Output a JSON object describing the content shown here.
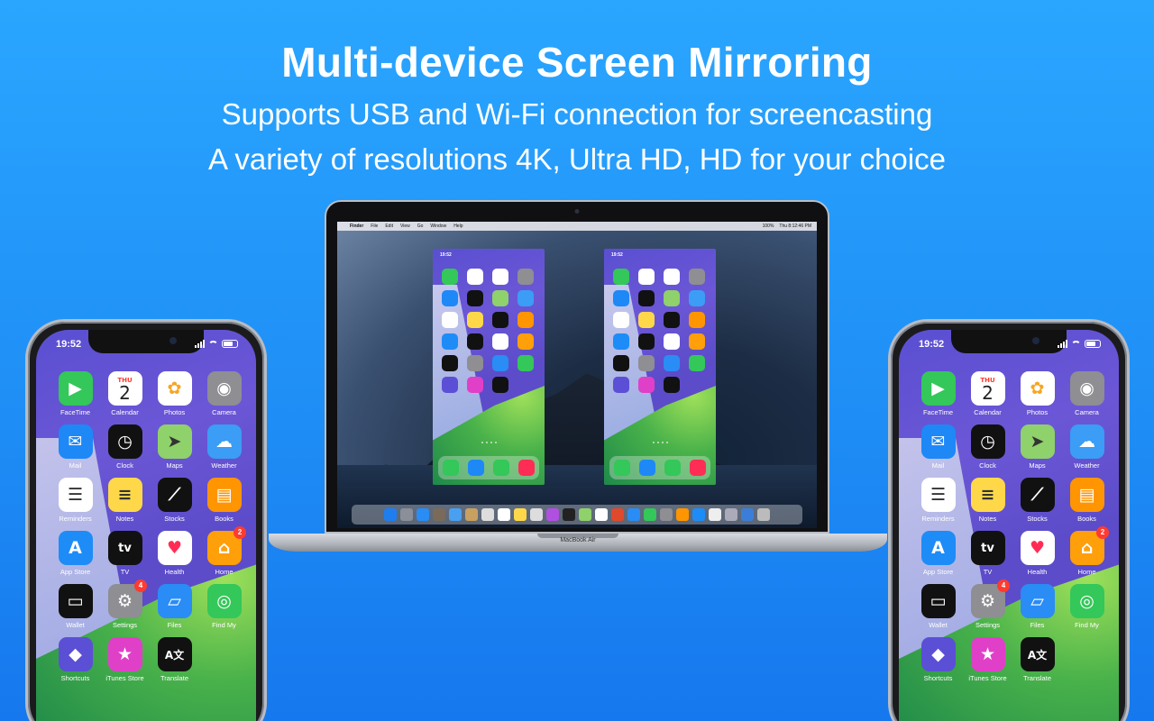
{
  "headline": {
    "title": "Multi-device Screen Mirroring",
    "line1": "Supports USB and Wi-Fi connection for screencasting",
    "line2": "A variety of resolutions 4K, Ultra HD, HD for your choice"
  },
  "phone": {
    "time": "19:52",
    "calendar_dow": "THU",
    "calendar_day": "2",
    "apps": [
      {
        "label": "FaceTime",
        "icon": "facetime-icon",
        "color": "#34c759",
        "glyph": "▶"
      },
      {
        "label": "Calendar",
        "icon": "calendar-icon",
        "color": "#ffffff",
        "glyph": ""
      },
      {
        "label": "Photos",
        "icon": "photos-icon",
        "color": "#ffffff",
        "glyph": "✿"
      },
      {
        "label": "Camera",
        "icon": "camera-icon",
        "color": "#8e8e93",
        "glyph": "◉"
      },
      {
        "label": "Mail",
        "icon": "mail-icon",
        "color": "#1e88f7",
        "glyph": "✉"
      },
      {
        "label": "Clock",
        "icon": "clock-icon",
        "color": "#111111",
        "glyph": "◷"
      },
      {
        "label": "Maps",
        "icon": "maps-icon",
        "color": "#8fd16a",
        "glyph": "➤"
      },
      {
        "label": "Weather",
        "icon": "weather-icon",
        "color": "#3b9df5",
        "glyph": "☁"
      },
      {
        "label": "Reminders",
        "icon": "reminders-icon",
        "color": "#ffffff",
        "glyph": "☰"
      },
      {
        "label": "Notes",
        "icon": "notes-icon",
        "color": "#ffd84a",
        "glyph": "≡"
      },
      {
        "label": "Stocks",
        "icon": "stocks-icon",
        "color": "#111111",
        "glyph": "⟋"
      },
      {
        "label": "Books",
        "icon": "books-icon",
        "color": "#ff9500",
        "glyph": "▤"
      },
      {
        "label": "App Store",
        "icon": "app-store-icon",
        "color": "#1e8cf7",
        "glyph": "A"
      },
      {
        "label": "TV",
        "icon": "tv-icon",
        "color": "#111111",
        "glyph": "tv"
      },
      {
        "label": "Health",
        "icon": "health-icon",
        "color": "#ffffff",
        "glyph": "♥"
      },
      {
        "label": "Home",
        "icon": "home-icon",
        "color": "#ff9f0a",
        "glyph": "⌂",
        "badge": "2"
      },
      {
        "label": "Wallet",
        "icon": "wallet-icon",
        "color": "#111111",
        "glyph": "▭"
      },
      {
        "label": "Settings",
        "icon": "settings-icon",
        "color": "#8e8e93",
        "glyph": "⚙",
        "badge": "4"
      },
      {
        "label": "Files",
        "icon": "files-icon",
        "color": "#2a8cf5",
        "glyph": "▱"
      },
      {
        "label": "Find My",
        "icon": "find-my-icon",
        "color": "#34c759",
        "glyph": "◎"
      },
      {
        "label": "Shortcuts",
        "icon": "shortcuts-icon",
        "color": "#5b4fd6",
        "glyph": "◆"
      },
      {
        "label": "iTunes Store",
        "icon": "itunes-store-icon",
        "color": "#e040c8",
        "glyph": "★"
      },
      {
        "label": "Translate",
        "icon": "translate-icon",
        "color": "#111111",
        "glyph": "A文"
      }
    ]
  },
  "laptop": {
    "label": "MacBook Air",
    "menubar": {
      "apple": "",
      "items": [
        "Finder",
        "File",
        "Edit",
        "View",
        "Go",
        "Window",
        "Help"
      ],
      "battery": "100%",
      "clock": "Thu 8:12:46 PM"
    },
    "mirror_time": "19:52"
  }
}
